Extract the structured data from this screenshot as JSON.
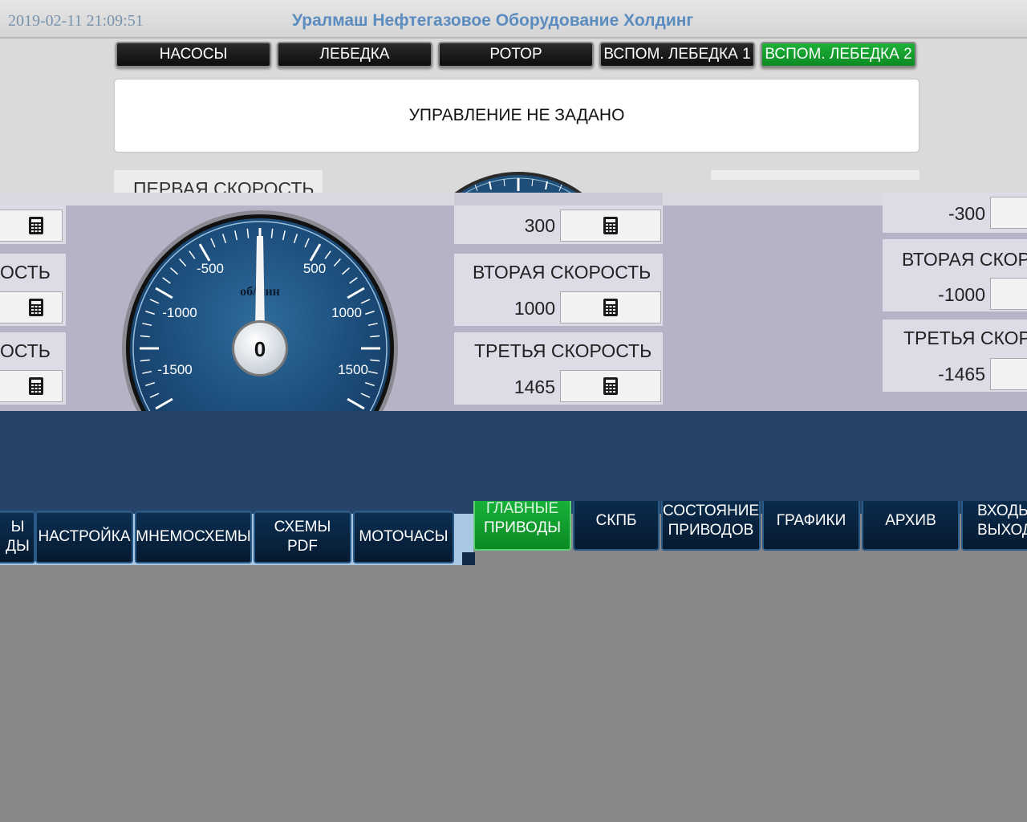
{
  "header": {
    "datetime": "2019-02-11 21:09:51",
    "company": "Уралмаш Нефтегазовое Оборудование Холдинг"
  },
  "top_tabs": [
    {
      "label": "НАСОСЫ",
      "active": false
    },
    {
      "label": "ЛЕБЕДКА",
      "active": false
    },
    {
      "label": "РОТОР",
      "active": false
    },
    {
      "label": "ВСПОМ. ЛЕБЕДКА 1",
      "active": false
    },
    {
      "label": "ВСПОМ. ЛЕБЕДКА 2",
      "active": true
    }
  ],
  "control_status": "УПРАВЛЕНИЕ НЕ ЗАДАНО",
  "left_panel": {
    "first_speed_title": "ПЕРВАЯ СКОРОСТЬ",
    "second_speed_title_partial": "ОСТЬ",
    "third_speed_title_partial": "ОСТЬ"
  },
  "gauge": {
    "unit": "об/мин",
    "value": "0",
    "tick_labels": [
      "-1500",
      "-1000",
      "-500",
      "500",
      "1000",
      "1500"
    ]
  },
  "center_panel": {
    "first_speed_value": "300",
    "second_speed_title": "ВТОРАЯ СКОРОСТЬ",
    "second_speed_value": "1000",
    "third_speed_title": "ТРЕТЬЯ СКОРОСТЬ",
    "third_speed_value": "1465"
  },
  "right_panel": {
    "first_speed_value": "-300",
    "second_speed_title": "ВТОРАЯ СКОРО",
    "second_speed_value": "-1000",
    "third_speed_title": "ТРЕТЬЯ СКОРО",
    "third_speed_value": "-1465"
  },
  "bottom_nav_left": [
    {
      "label": "ЫЫ\nДЫ",
      "line1": "Ы",
      "line2": "ДЫ"
    },
    {
      "label": "НАСТРОЙКА"
    },
    {
      "label": "МНЕМОСХЕМЫ"
    },
    {
      "label": "СХЕМЫ PDF",
      "line1": "СХЕМЫ",
      "line2": "PDF"
    },
    {
      "label": "МОТОЧАСЫ"
    }
  ],
  "bottom_nav_right": [
    {
      "label": "ГЛАВНЫЕ ПРИВОДЫ",
      "line1": "ГЛАВНЫЕ",
      "line2": "ПРИВОДЫ",
      "active": true
    },
    {
      "label": "СКПБ"
    },
    {
      "label": "СОСТОЯНИЕ ПРИВОДОВ",
      "line1": "СОСТОЯНИЕ",
      "line2": "ПРИВОДОВ"
    },
    {
      "label": "ГРАФИКИ"
    },
    {
      "label": "АРХИВ"
    },
    {
      "label": "ВХОДЫ ВЫХОДЫ",
      "line1": "ВХОДЫ",
      "line2": "ВЫХОДЫ"
    }
  ],
  "colors": {
    "active_green": "#12a332",
    "nav_dark": "#0a2440",
    "band_blue": "#264468",
    "title_blue": "#5b8cc0"
  }
}
